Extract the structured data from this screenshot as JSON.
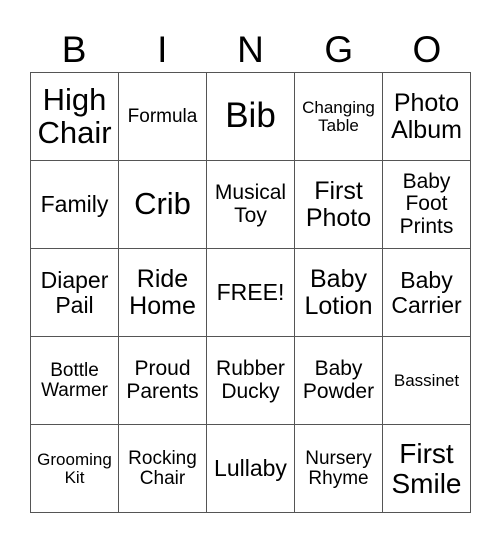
{
  "header": [
    "B",
    "I",
    "N",
    "G",
    "O"
  ],
  "rows": [
    [
      "High Chair",
      "Formula",
      "Bib",
      "Changing Table",
      "Photo Album"
    ],
    [
      "Family",
      "Crib",
      "Musical Toy",
      "First Photo",
      "Baby Foot Prints"
    ],
    [
      "Diaper Pail",
      "Ride Home",
      "FREE!",
      "Baby Lotion",
      "Baby Carrier"
    ],
    [
      "Bottle Warmer",
      "Proud Parents",
      "Rubber Ducky",
      "Baby Powder",
      "Bassinet"
    ],
    [
      "Grooming Kit",
      "Rocking Chair",
      "Lullaby",
      "Nursery Rhyme",
      "First Smile"
    ]
  ]
}
